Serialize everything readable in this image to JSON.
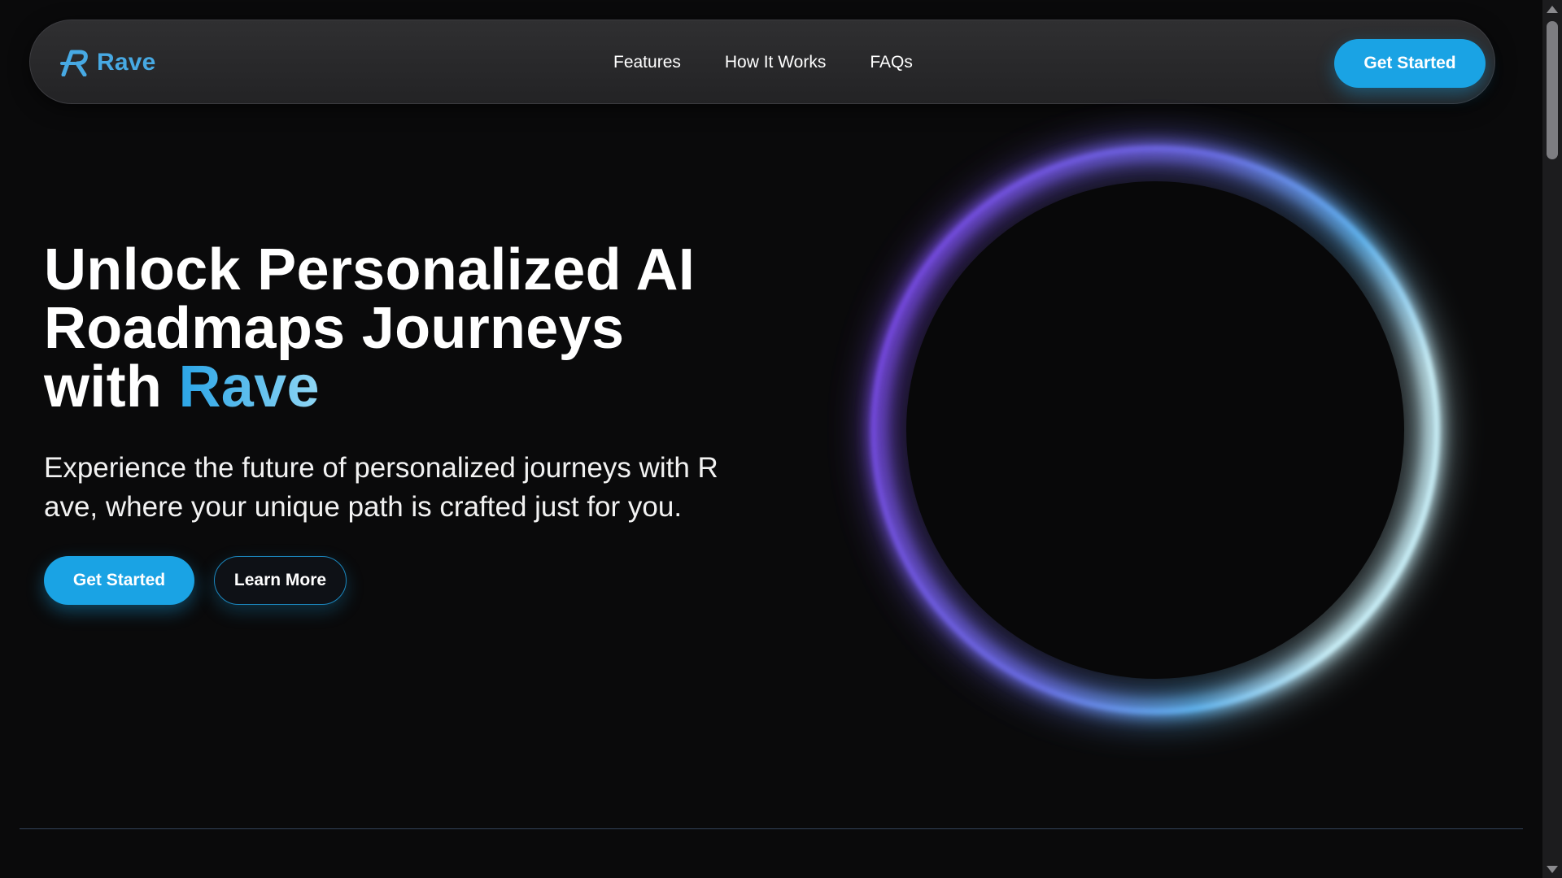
{
  "nav": {
    "brand_name": "Rave",
    "links": [
      {
        "label": "Features"
      },
      {
        "label": "How It Works"
      },
      {
        "label": "FAQs"
      }
    ],
    "cta_label": "Get Started"
  },
  "hero": {
    "title_line1": "Unlock Personalized AI",
    "title_line2": "Roadmaps Journeys",
    "title_line3_prefix": "with ",
    "title_accent": "Rave",
    "subtitle_line1": "Experience the future of personalized journeys with R",
    "subtitle_line2": "ave, where your unique path is crafted just for you.",
    "primary_label": "Get Started",
    "secondary_label": "Learn More"
  },
  "colors": {
    "accent": "#1aa3e4",
    "brand": "#47a9e3",
    "background": "#0a0a0b",
    "navbar": "#2a2a2c",
    "ring_start": "#7a3fe0",
    "ring_end": "#bff2ff"
  },
  "icons": {
    "brand_logo": "rave-logo-icon",
    "scroll_up": "scroll-up-arrow-icon",
    "scroll_down": "scroll-down-arrow-icon"
  }
}
